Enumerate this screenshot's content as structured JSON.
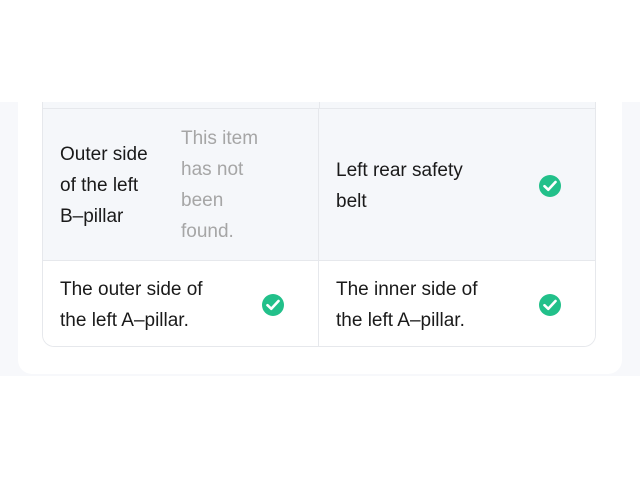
{
  "inspection_items": {
    "rows": [
      [
        {
          "label": "Outer side of the left B–pillar",
          "label_lines": [
            "Outer side",
            "of the left",
            "B–pillar"
          ],
          "status": "This item has not been found.",
          "status_lines": [
            "This item",
            "has not",
            "been",
            "found."
          ],
          "checked": false
        },
        {
          "label": "Left rear safety belt",
          "label_lines": [
            "Left rear safety",
            "belt"
          ],
          "checked": true
        }
      ],
      [
        {
          "label": "The outer side of the left A–pillar.",
          "label_lines": [
            "The outer side of",
            "the left A–pillar."
          ],
          "checked": true
        },
        {
          "label": "The inner side of the left A–pillar.",
          "label_lines": [
            "The inner side of",
            "the left A–pillar."
          ],
          "checked": true
        }
      ]
    ]
  },
  "colors": {
    "check": "#22c08a",
    "not_found_text": "#a6a6a6",
    "row_highlight": "#f5f7fa"
  },
  "icons": {
    "checked": "check-circle-icon"
  }
}
